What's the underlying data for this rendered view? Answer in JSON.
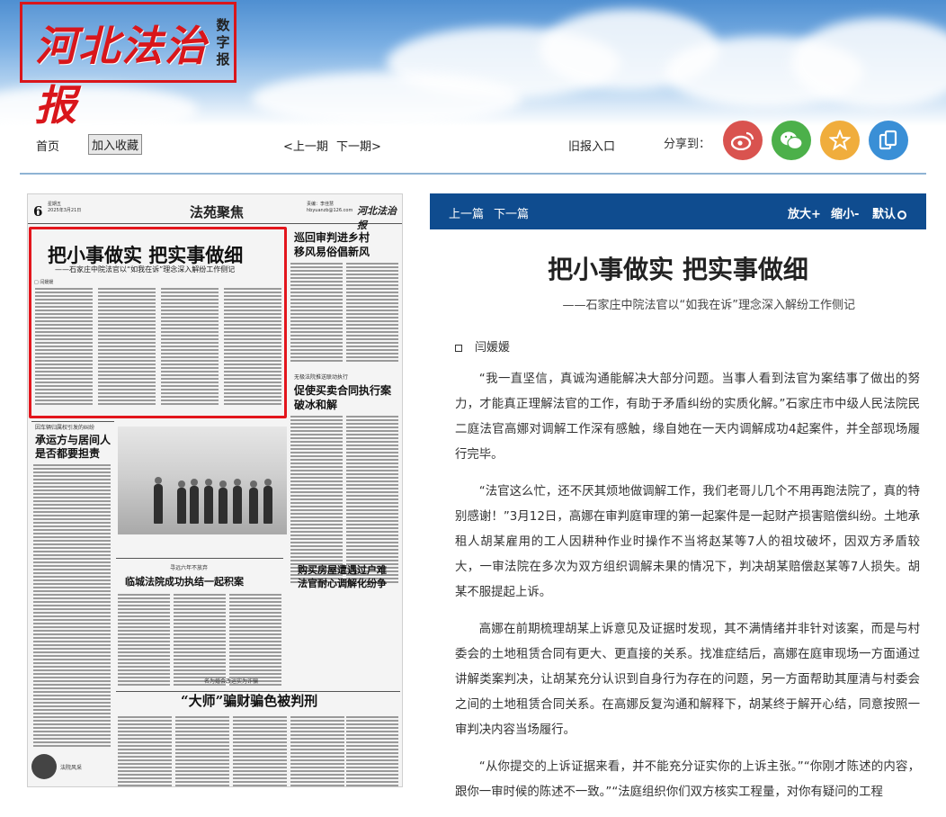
{
  "site": {
    "logo_text": "河北法治报",
    "logo_sub": "数字报"
  },
  "nav": {
    "home": "首页",
    "favorite": "加入收藏",
    "prev_issue": "<上一期",
    "next_issue": "下一期>",
    "old_issues": "旧报入口",
    "share_label": "分享到：",
    "share_targets": [
      "weibo-icon",
      "wechat-icon",
      "star-icon",
      "copy-icon"
    ],
    "share_colors": [
      "#d9534f",
      "#4cb04a",
      "#f0ad3c",
      "#3a8fd6"
    ]
  },
  "paper_page": {
    "page_number": "6",
    "date_line": "星期五",
    "date_line2": "2025年3月21日",
    "section": "法苑聚焦",
    "editor_line": "责编：李佳慧",
    "editor_line2": "hbyuanzb@126.com",
    "brand": "河北法治报",
    "lead_title": "把小事做实  把实事做细",
    "lead_subtitle": "——石家庄中院法官以“如我在诉”理念深入解纷工作侧记",
    "lead_author": "□  闫媛媛",
    "right_title": "巡回审判进乡村\n移风易俗倡新风",
    "right_kicker": "无极法院推送联动执行",
    "right_title2": "促使买卖合同执行案\n破冰和解",
    "left_kicker": "因车辆归属权引发的纠纷",
    "left_title": "承运方与居间人\n是否都要担责",
    "mid_kicker": "寻远六年不放弃",
    "mid_title": "临城法院成功执结一起积案",
    "mid_right_title": "购买房屋遭遇过户难\n法官耐心调解化纷争",
    "bottom_kicker": "名为婚会改运实为诈骗",
    "bottom_title": "“大师”骗财骗色被判刑",
    "footer_label": "法院风采"
  },
  "article": {
    "prev": "上一篇",
    "next": "下一篇",
    "zoom_in": "放大+",
    "zoom_out": "缩小-",
    "default": "默认",
    "title": "把小事做实 把实事做细",
    "subtitle": "——石家庄中院法官以“如我在诉”理念深入解纷工作侧记",
    "author": "闫媛媛",
    "paragraphs": [
      "“我一直坚信，真诚沟通能解决大部分问题。当事人看到法官为案结事了做出的努力，才能真正理解法官的工作，有助于矛盾纠纷的实质化解。”石家庄市中级人民法院民二庭法官高娜对调解工作深有感触，缘自她在一天内调解成功4起案件，并全部现场履行完毕。",
      "“法官这么忙，还不厌其烦地做调解工作，我们老哥儿几个不用再跑法院了，真的特别感谢！”3月12日，高娜在审判庭审理的第一起案件是一起财产损害赔偿纠纷。土地承租人胡某雇用的工人因耕种作业时操作不当将赵某等7人的祖坟破坏，因双方矛盾较大，一审法院在多次为双方组织调解未果的情况下，判决胡某赔偿赵某等7人损失。胡某不服提起上诉。",
      "高娜在前期梳理胡某上诉意见及证据时发现，其不满情绪并非针对该案，而是与村委会的土地租赁合同有更大、更直接的关系。找准症结后，高娜在庭审现场一方面通过讲解类案判决，让胡某充分认识到自身行为存在的问题，另一方面帮助其厘清与村委会之间的土地租赁合同关系。在高娜反复沟通和解释下，胡某终于解开心结，同意按照一审判决内容当场履行。",
      "“从你提交的上诉证据来看，并不能充分证实你的上诉主张。”“你刚才陈述的内容，跟你一审时候的陈述不一致。”“法庭组织你们双方核实工程量，对你有疑问的工程"
    ]
  }
}
